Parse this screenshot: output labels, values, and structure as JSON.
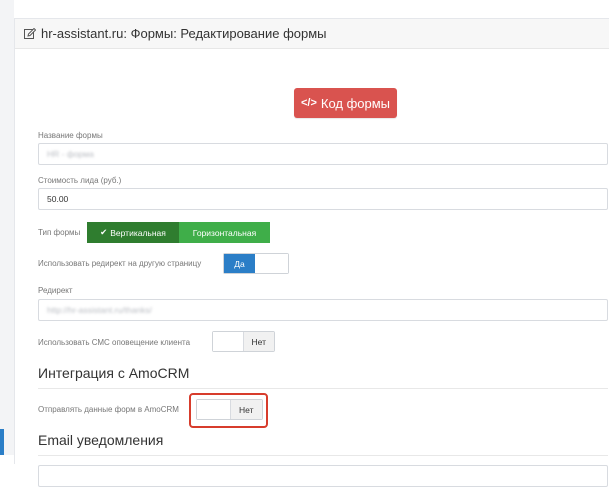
{
  "panel": {
    "title": "hr-assistant.ru: Формы: Редактирование формы",
    "code_button": "Код формы",
    "code_icon": "</>"
  },
  "fields": {
    "form_name": {
      "label": "Название формы",
      "value": "HR - форма"
    },
    "lead_cost": {
      "label": "Стоимость лида (руб.)",
      "value": "50.00"
    },
    "form_type": {
      "label": "Тип формы",
      "options": [
        "Вертикальная",
        "Горизонтальная"
      ],
      "selected": "Вертикальная",
      "check_icon": "✔"
    },
    "use_redirect": {
      "label": "Использовать редирект на другую страницу",
      "on_label": "Да"
    },
    "redirect": {
      "label": "Редирект",
      "value": "http://hr-assistant.ru/thanks/"
    },
    "sms_notify": {
      "label": "Использовать СМС оповещение клиента",
      "off_label": "Нет"
    }
  },
  "amocrm": {
    "title": "Интеграция с AmoCRM",
    "send_label": "Отправлять данные форм в AmoCRM",
    "off_label": "Нет"
  },
  "email": {
    "title": "Email уведомления"
  },
  "colors": {
    "danger": "#d9534f",
    "success_active": "#2f7d2f",
    "success": "#3fae49",
    "primary": "#2b7ec7",
    "highlight": "#d73c2c"
  }
}
